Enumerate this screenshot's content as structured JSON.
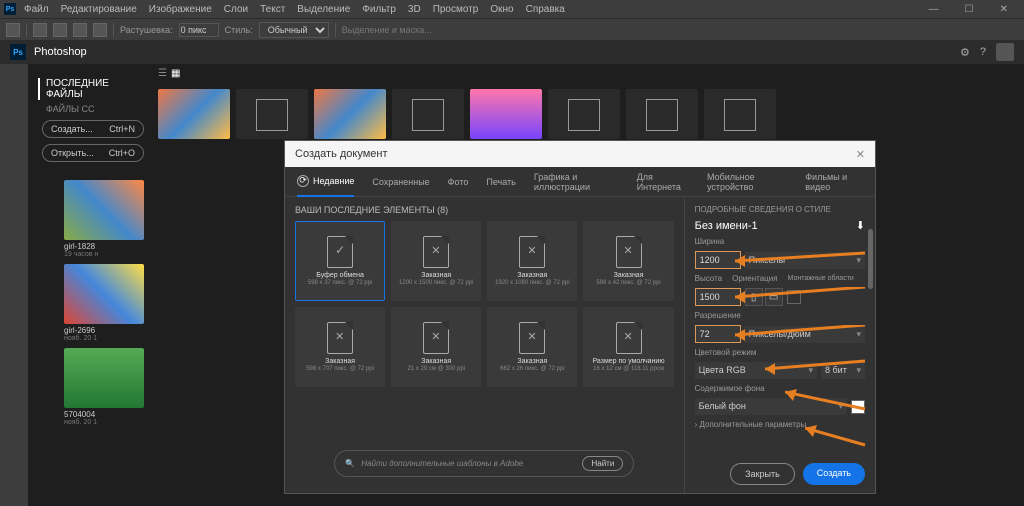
{
  "app": {
    "name": "Photoshop",
    "logo": "Ps"
  },
  "menubar": [
    "Файл",
    "Редактирование",
    "Изображение",
    "Слои",
    "Текст",
    "Выделение",
    "Фильтр",
    "3D",
    "Просмотр",
    "Окно",
    "Справка"
  ],
  "optbar": {
    "feather_lbl": "Растушевка:",
    "feather_val": "0 пикс",
    "style_lbl": "Стиль:",
    "style_val": "Обычный",
    "mask": "Выделение и маска..."
  },
  "left": {
    "recent": "ПОСЛЕДНИЕ ФАЙЛЫ",
    "cc": "ФАЙЛЫ CC",
    "create": "Создать...",
    "create_key": "Ctrl+N",
    "open": "Открыть...",
    "open_key": "Ctrl+O"
  },
  "recent_items": [
    {
      "name": "girl-1828",
      "sub": "19 часов н"
    },
    {
      "name": "girl-2696",
      "sub": "нояб. 20 1"
    },
    {
      "name": "5704004",
      "sub": "нояб. 20 1"
    }
  ],
  "dialog": {
    "title": "Создать документ",
    "tabs": [
      "Недавние",
      "Сохраненные",
      "Фото",
      "Печать",
      "Графика и иллюстрации",
      "Для Интернета",
      "Мобильное устройство",
      "Фильмы и видео"
    ],
    "active_tab": 0,
    "presets_hdr": "ВАШИ ПОСЛЕДНИЕ ЭЛЕМЕНТЫ",
    "presets_count": "(8)",
    "presets": [
      {
        "name": "Буфер обмена",
        "dim": "598 x 37 пикс. @ 72 ppi",
        "sel": true,
        "kind": "chk"
      },
      {
        "name": "Заказная",
        "dim": "1200 x 1500 пикс. @ 72 ppi",
        "kind": "x"
      },
      {
        "name": "Заказная",
        "dim": "1920 x 1080 пикс. @ 72 ppi",
        "kind": "x"
      },
      {
        "name": "Заказная",
        "dim": "598 x 42 пикс. @ 72 ppi",
        "kind": "x"
      },
      {
        "name": "Заказная",
        "dim": "598 x 707 пикс. @ 72 ppi",
        "kind": "x"
      },
      {
        "name": "Заказная",
        "dim": "21 x 29 см @ 300 ppi",
        "kind": "x"
      },
      {
        "name": "Заказная",
        "dim": "662 x 26 пикс. @ 72 ppi",
        "kind": "x"
      },
      {
        "name": "Размер по умолчанию",
        "dim": "16 x 12 см @ 118.11 ррсм",
        "kind": "x"
      }
    ],
    "search_placeholder": "Найти дополнительные шаблоны в Adobe",
    "search_btn": "Найти",
    "details": {
      "hdr": "ПОДРОБНЫЕ СВЕДЕНИЯ О СТИЛЕ",
      "name": "Без имени-1",
      "width_lbl": "Ширина",
      "width": "1200",
      "width_unit": "Пикселы",
      "height_lbl": "Высота",
      "orient_lbl": "Ориентация",
      "art_lbl": "Монтажные области",
      "height": "1500",
      "res_lbl": "Разрешение",
      "res": "72",
      "res_unit": "Пикселы/дюйм",
      "color_lbl": "Цветовой режим",
      "color_mode": "Цвета RGB",
      "bits": "8 бит",
      "bg_lbl": "Содержимое фона",
      "bg": "Белый фон",
      "adv": "Дополнительные параметры"
    },
    "close_btn": "Закрыть",
    "create_btn": "Создать"
  }
}
